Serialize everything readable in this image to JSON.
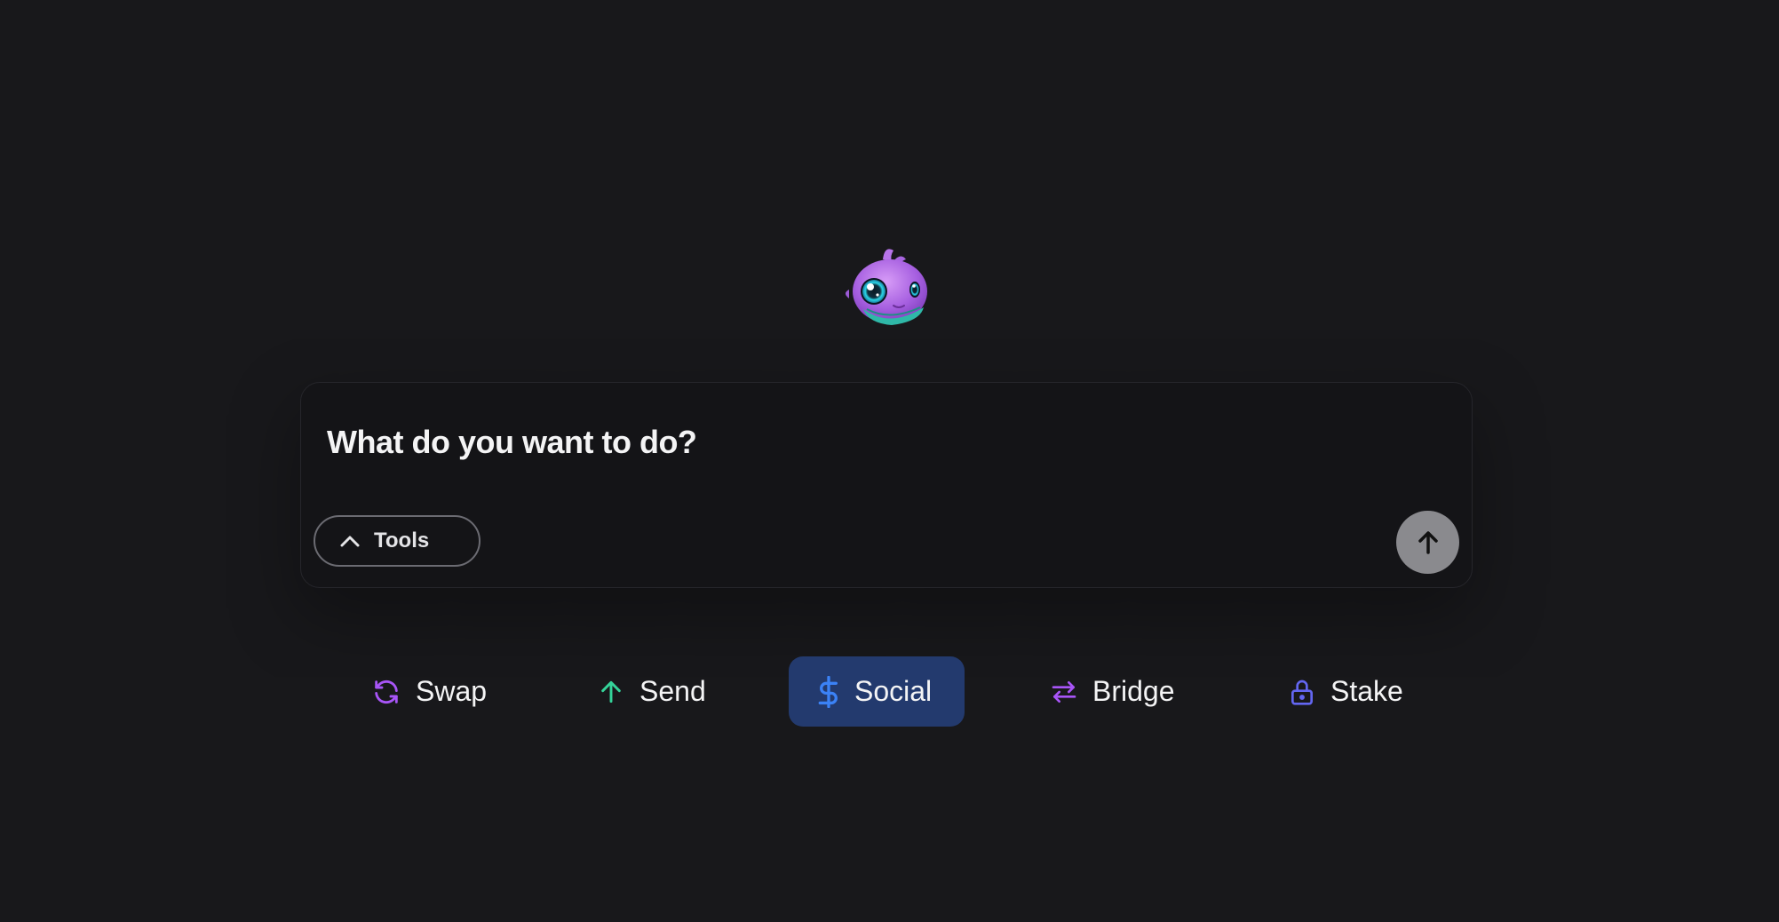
{
  "composer": {
    "placeholder": "What do you want to do?",
    "tools_label": "Tools"
  },
  "actions": [
    {
      "label": "Swap",
      "icon": "refresh-icon",
      "color": "#a855f7"
    },
    {
      "label": "Send",
      "icon": "arrow-up-icon",
      "color": "#34d399"
    },
    {
      "label": "Social",
      "icon": "dollar-icon",
      "color": "#3b82f6",
      "active": true
    },
    {
      "label": "Bridge",
      "icon": "swap-arrows-icon",
      "color": "#a855f7"
    },
    {
      "label": "Stake",
      "icon": "lock-icon",
      "color": "#6366f1"
    }
  ],
  "colors": {
    "background": "#18181b",
    "active_chip": "#233a6e",
    "send_button": "#8a8a8e"
  }
}
